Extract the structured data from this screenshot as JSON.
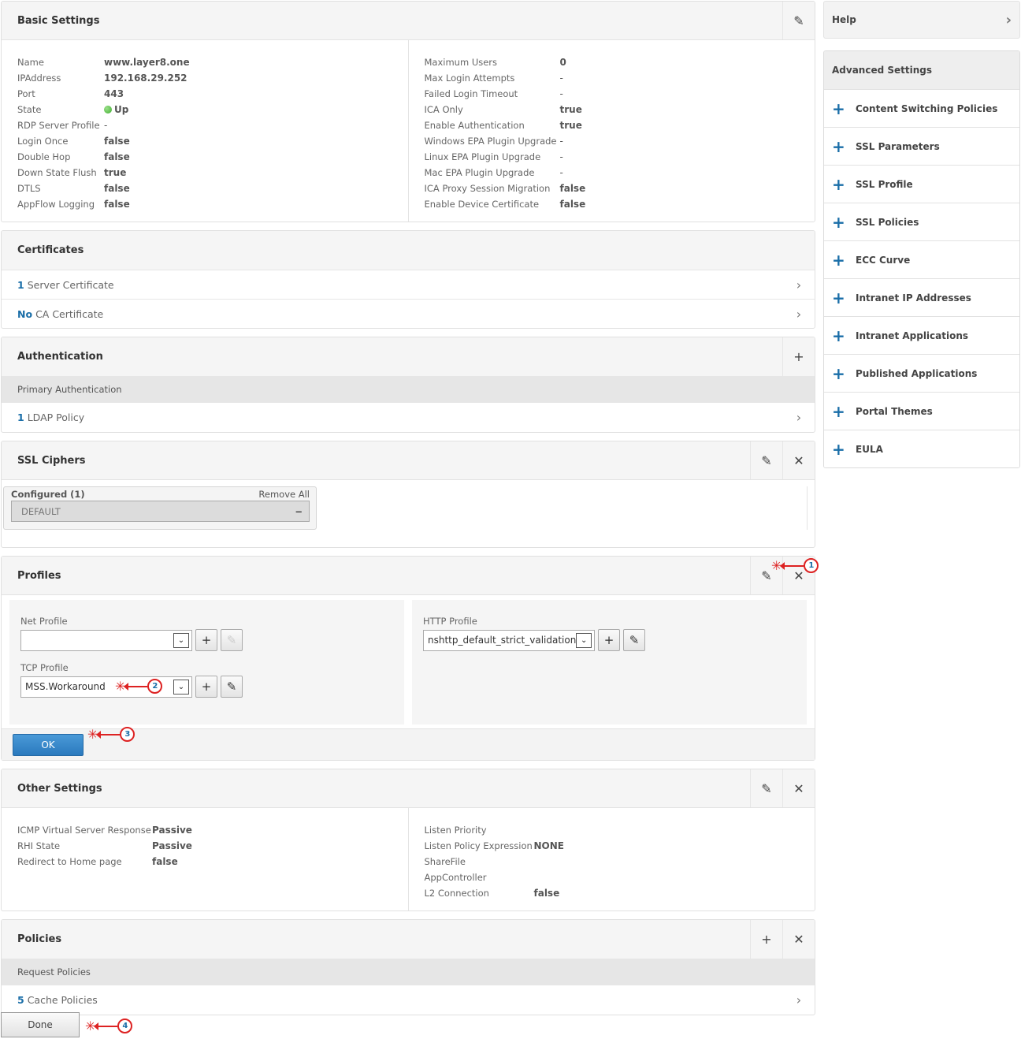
{
  "basic_settings": {
    "title": "Basic Settings",
    "left": [
      {
        "label": "Name",
        "value": "www.layer8.one"
      },
      {
        "label": "IPAddress",
        "value": "192.168.29.252"
      },
      {
        "label": "Port",
        "value": "443"
      },
      {
        "label": "State",
        "value": "Up"
      },
      {
        "label": "RDP Server Profile",
        "value": "-"
      },
      {
        "label": "Login Once",
        "value": "false"
      },
      {
        "label": "Double Hop",
        "value": "false"
      },
      {
        "label": "Down State Flush",
        "value": "true"
      },
      {
        "label": "DTLS",
        "value": "false"
      },
      {
        "label": "AppFlow Logging",
        "value": "false"
      }
    ],
    "right": [
      {
        "label": "Maximum Users",
        "value": "0"
      },
      {
        "label": "Max Login Attempts",
        "value": "-"
      },
      {
        "label": "Failed Login Timeout",
        "value": "-"
      },
      {
        "label": "ICA Only",
        "value": "true"
      },
      {
        "label": "Enable Authentication",
        "value": "true"
      },
      {
        "label": "Windows EPA Plugin Upgrade",
        "value": "-"
      },
      {
        "label": "Linux EPA Plugin Upgrade",
        "value": "-"
      },
      {
        "label": "Mac EPA Plugin Upgrade",
        "value": "-"
      },
      {
        "label": "ICA Proxy Session Migration",
        "value": "false"
      },
      {
        "label": "Enable Device Certificate",
        "value": "false"
      }
    ]
  },
  "certificates": {
    "title": "Certificates",
    "rows": [
      {
        "count": "1",
        "label": "Server Certificate"
      },
      {
        "count": "No",
        "label": "CA Certificate"
      }
    ]
  },
  "authentication": {
    "title": "Authentication",
    "subheader": "Primary Authentication",
    "rows": [
      {
        "count": "1",
        "label": "LDAP Policy"
      }
    ]
  },
  "ssl_ciphers": {
    "title": "SSL Ciphers",
    "configured_label": "Configured (1)",
    "remove_all": "Remove All",
    "items": [
      "DEFAULT"
    ],
    "remove_glyph": "−"
  },
  "profiles": {
    "title": "Profiles",
    "net_profile": {
      "label": "Net Profile",
      "value": ""
    },
    "tcp_profile": {
      "label": "TCP Profile",
      "value": "MSS.Workaround"
    },
    "http_profile": {
      "label": "HTTP Profile",
      "value": "nshttp_default_strict_validation"
    },
    "ok_label": "OK"
  },
  "other_settings": {
    "title": "Other Settings",
    "left": [
      {
        "label": "ICMP Virtual Server Response",
        "value": "Passive"
      },
      {
        "label": "RHI State",
        "value": "Passive"
      },
      {
        "label": "Redirect to Home page",
        "value": "false"
      }
    ],
    "right": [
      {
        "label": "Listen Priority",
        "value": ""
      },
      {
        "label": "Listen Policy Expression",
        "value": "NONE"
      },
      {
        "label": "ShareFile",
        "value": ""
      },
      {
        "label": "AppController",
        "value": ""
      },
      {
        "label": "L2 Connection",
        "value": "false"
      }
    ]
  },
  "policies": {
    "title": "Policies",
    "subheader": "Request Policies",
    "rows": [
      {
        "count": "5",
        "label": "Cache Policies"
      }
    ]
  },
  "done_label": "Done",
  "sidebar": {
    "help": "Help",
    "advanced_title": "Advanced Settings",
    "items": [
      "Content Switching Policies",
      "SSL Parameters",
      "SSL Profile",
      "SSL Policies",
      "ECC Curve",
      "Intranet IP Addresses",
      "Intranet Applications",
      "Published Applications",
      "Portal Themes",
      "EULA"
    ]
  },
  "icons": {
    "edit": "✎",
    "close": "✕",
    "add": "+",
    "chevron": "›",
    "dropdown": "⌄",
    "burst": "✳"
  },
  "annotations": [
    "1",
    "2",
    "3",
    "4"
  ],
  "colors": {
    "accent": "#1a6ea8",
    "ok_button": "#2a79bd",
    "annotation": "#dd2222",
    "state_up": "#3fae2f"
  }
}
